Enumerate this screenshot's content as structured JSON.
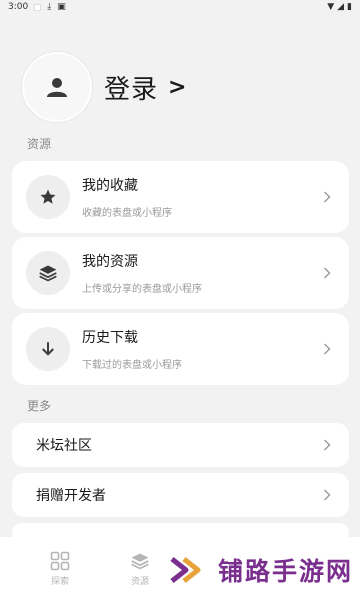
{
  "status_bar": {
    "time": "3:00"
  },
  "profile": {
    "login_label": "登录",
    "chevron": ">"
  },
  "sections": {
    "resources_title": "资源",
    "more_title": "更多"
  },
  "resource_cards": [
    {
      "title": "我的收藏",
      "subtitle": "收藏的表盘或小程序",
      "icon": "star-icon"
    },
    {
      "title": "我的资源",
      "subtitle": "上传或分享的表盘或小程序",
      "icon": "layers-icon"
    },
    {
      "title": "历史下载",
      "subtitle": "下载过的表盘或小程序",
      "icon": "download-arrow-icon"
    }
  ],
  "more_rows": [
    {
      "label": "米坛社区"
    },
    {
      "label": "捐赠开发者"
    }
  ],
  "bottom_nav": {
    "items": [
      {
        "label": "探索",
        "icon": "grid-icon"
      },
      {
        "label": "资源",
        "icon": "layers-icon"
      }
    ]
  },
  "watermark": {
    "text": "铺路手游网"
  },
  "colors": {
    "background": "#f2f2f2",
    "card": "#ffffff",
    "watermark": "#7a2f8e",
    "watermark_accent": "#e8a33a"
  }
}
